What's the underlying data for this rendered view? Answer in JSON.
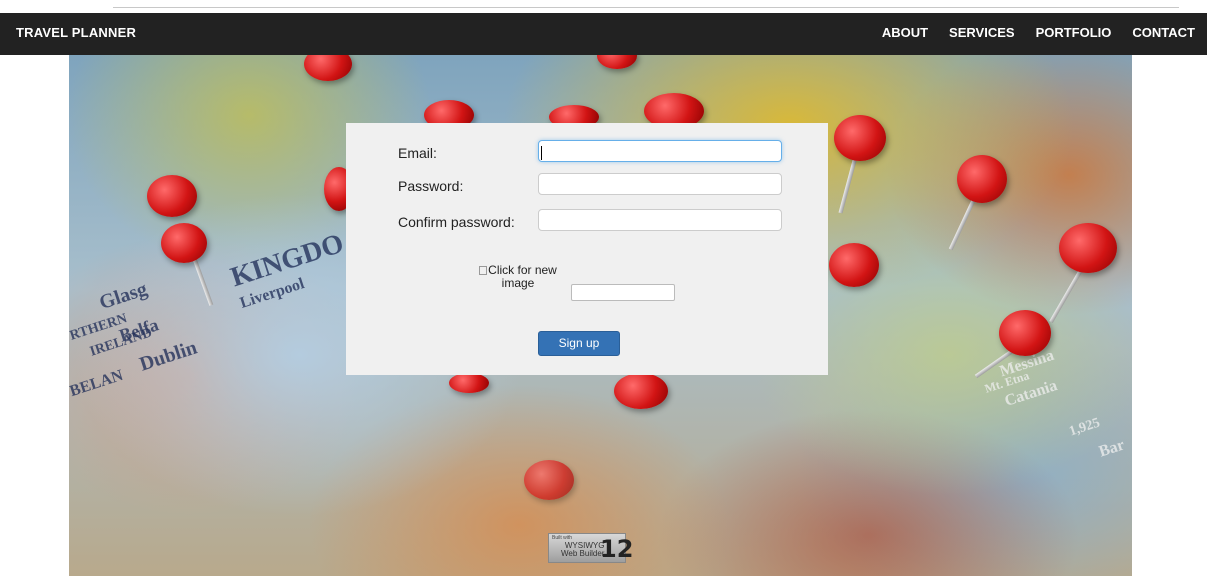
{
  "navbar": {
    "brand": "TRAVEL PLANNER",
    "links": [
      "ABOUT",
      "SERVICES",
      "PORTFOLIO",
      "CONTACT"
    ]
  },
  "hero": {
    "map_labels": [
      "KINGDO",
      "Glasg",
      "RTHERN",
      "IRELAND",
      "Belfa",
      "Dublin",
      "Liverpool",
      "BELAN",
      "Messina",
      "Mt. Etna",
      "Catania",
      "1,925",
      "Bar"
    ]
  },
  "signup_form": {
    "email": {
      "label": "Email:",
      "value": "",
      "placeholder": ""
    },
    "password": {
      "label": "Password:",
      "value": "",
      "placeholder": ""
    },
    "confirm_password": {
      "label": "Confirm password:",
      "value": "",
      "placeholder": ""
    },
    "captcha": {
      "image_alt": "Click for new image",
      "value": ""
    },
    "submit_label": "Sign up"
  },
  "footer_badge": {
    "small_text": "Built with",
    "line1": "WYSIWYG",
    "line2": "Web Builder",
    "version": "12"
  },
  "colors": {
    "navbar_bg": "#222222",
    "panel_bg": "#f0f0f0",
    "button_bg": "#3472b5",
    "focus_border": "#66afe9"
  }
}
